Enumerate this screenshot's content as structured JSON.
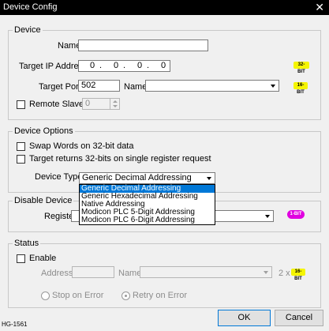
{
  "window": {
    "title": "Device Config",
    "close_glyph": "✕"
  },
  "device": {
    "group_label": "Device",
    "name_label": "Name:",
    "name_value": "",
    "ip_label": "Target IP Address :",
    "ip_segments": [
      "0",
      "0",
      "0",
      "0"
    ],
    "ip_dots": [
      ".",
      ".",
      "."
    ],
    "ip_badge": "32-BIT",
    "port_label": "Target Port  :",
    "port_value": "502",
    "port_name_label": "Name:",
    "port_name_value": "",
    "port_badge": "16-BIT",
    "slave_label": "Remote Slave Id",
    "slave_value": "0"
  },
  "options": {
    "group_label": "Device Options",
    "swap_label": "Swap Words on 32-bit data",
    "target32_label": "Target returns 32-bits on single register request",
    "type_label": "Device Type:",
    "type_value": "Generic Decimal Addressing",
    "type_options": [
      "Generic Decimal Addressing",
      "Generic Hexadecimal Addressing",
      "Native Addressing",
      "Modicon PLC 5-Digit Addressing",
      "Modicon PLC 6-Digit Addressing"
    ],
    "selected_index": 0
  },
  "disable": {
    "group_label": "Disable Device",
    "register_label": "Register:",
    "register_value": "",
    "badge": "1-BIT"
  },
  "status": {
    "group_label": "Status",
    "enable_label": "Enable",
    "address_label": "Address:",
    "address_value": "",
    "name_label": "Name:",
    "name_value": "",
    "multiplier": "2 x",
    "badge": "16-BIT",
    "stop_label": "Stop on Error",
    "retry_label": "Retry on Error"
  },
  "buttons": {
    "ok": "OK",
    "cancel": "Cancel"
  },
  "footer": {
    "code": "HG-1561"
  },
  "colors": {
    "badge_yellow": "#f5f500",
    "badge_magenta": "#e000e0",
    "selection_blue": "#0078d7"
  }
}
